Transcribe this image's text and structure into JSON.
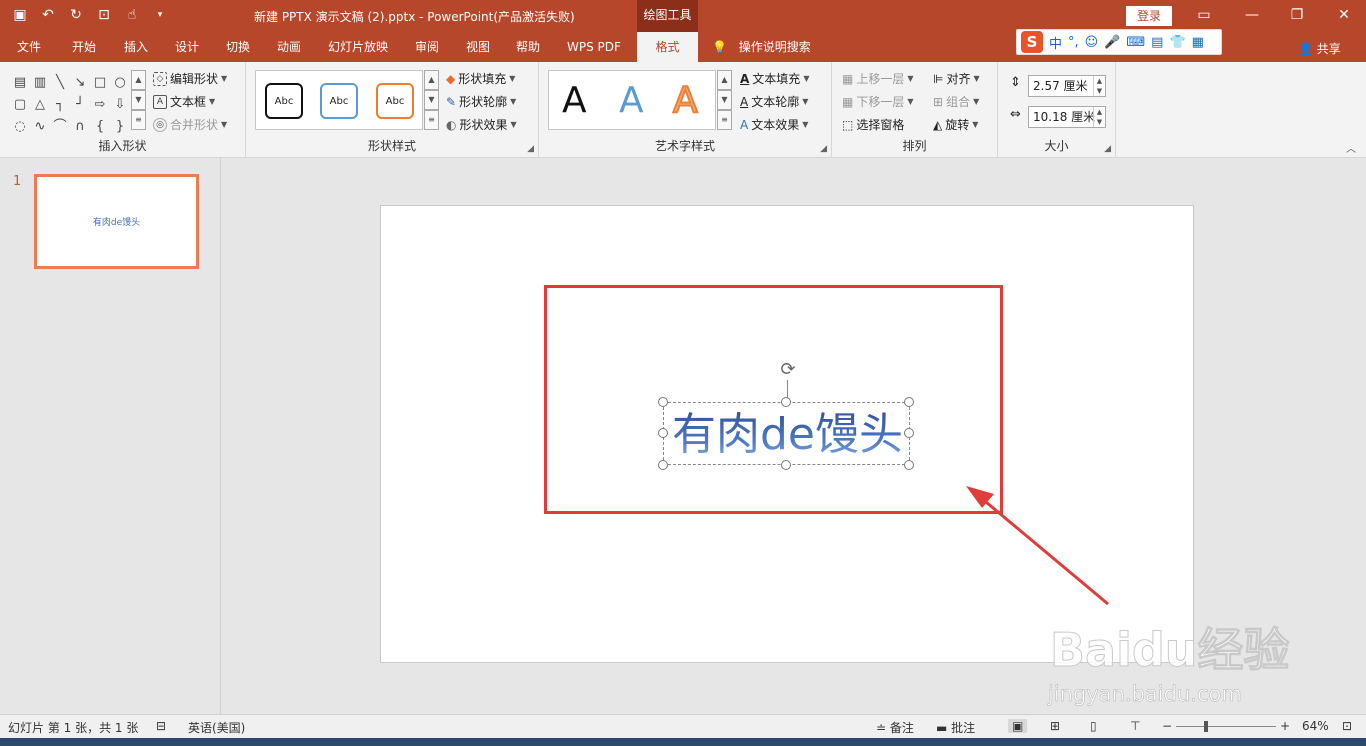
{
  "window": {
    "title": "新建 PPTX 演示文稿 (2).pptx  -  PowerPoint(产品激活失败)",
    "context_tab": "绘图工具",
    "login": "登录",
    "share": "共享"
  },
  "tabs": [
    "文件",
    "开始",
    "插入",
    "设计",
    "切换",
    "动画",
    "幻灯片放映",
    "审阅",
    "视图",
    "帮助",
    "WPS PDF",
    "格式"
  ],
  "active_tab": "格式",
  "tell_me": "操作说明搜索",
  "ime": {
    "mode": "中",
    "punct": "°,"
  },
  "ribbon": {
    "insert_shapes": {
      "label": "插入形状",
      "edit_shape": "编辑形状",
      "textbox": "文本框",
      "merge_shapes": "合并形状"
    },
    "shape_styles": {
      "label": "形状样式",
      "presets": [
        "Abc",
        "Abc",
        "Abc"
      ],
      "fill": "形状填充",
      "outline": "形状轮廓",
      "effects": "形状效果"
    },
    "wordart_styles": {
      "label": "艺术字样式",
      "presets": [
        "A",
        "A",
        "A"
      ],
      "text_fill": "文本填充",
      "text_outline": "文本轮廓",
      "text_effects": "文本效果"
    },
    "arrange": {
      "label": "排列",
      "bring_forward": "上移一层",
      "send_backward": "下移一层",
      "selection_pane": "选择窗格",
      "align": "对齐",
      "group": "组合",
      "rotate": "旋转"
    },
    "size": {
      "label": "大小",
      "height": "2.57 厘米",
      "width": "10.18 厘米"
    }
  },
  "thumbnails": [
    {
      "number": "1",
      "text": "有肉de馒头"
    }
  ],
  "slide": {
    "text": "有肉de馒头"
  },
  "watermark": {
    "logo": "Baidu经验",
    "url": "jingyan.baidu.com"
  },
  "status": {
    "slide_info": "幻灯片 第 1 张，共 1 张",
    "language": "英语(美国)",
    "notes": "备注",
    "comments": "批注",
    "zoom": "64%",
    "zoom_fraction": 0.64
  },
  "colors": {
    "brand": "#b7472a",
    "highlight": "#e03c3c",
    "text": "#3e62a8"
  }
}
